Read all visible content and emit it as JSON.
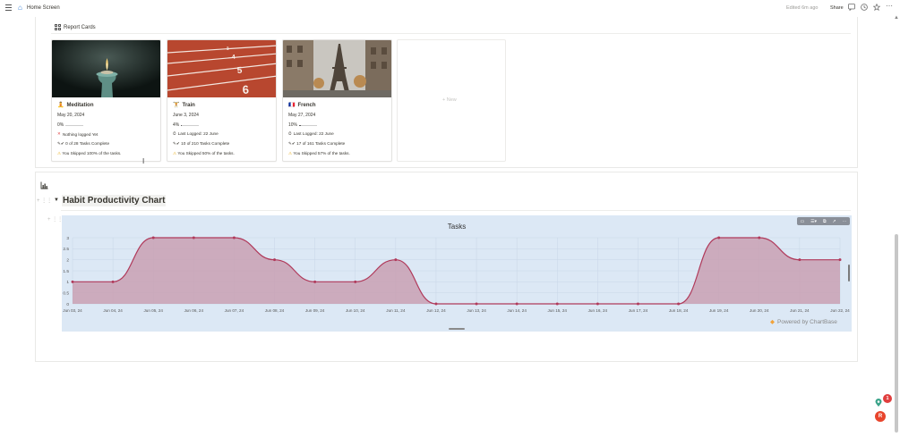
{
  "topbar": {
    "title": "Home Screen",
    "edited": "Edited 6m ago",
    "share_label": "Share"
  },
  "report_cards": {
    "header": "Report Cards",
    "new_label": "+ New",
    "cards": [
      {
        "title": "Meditation",
        "icon": "🧘",
        "date": "May 20, 2024",
        "progress": "0%",
        "progress_value": 0,
        "status_icon": "✕",
        "status_color": "#e03e3e",
        "status": "Nothing logged Yet",
        "tasks": "0 of 28 Tasks Complete",
        "skipped": "You Skipped 100% of the tasks."
      },
      {
        "title": "Train",
        "icon": "🏋",
        "date": "June 3, 2024",
        "progress": "4%",
        "progress_value": 4,
        "status_icon": "⏱",
        "status_color": "#37352f",
        "status": "Last Logged: 22 June",
        "tasks": "10 of 210 Tasks Complete",
        "skipped": "You Skipped 50% of the tasks."
      },
      {
        "title": "French",
        "icon": "🇫🇷",
        "date": "May 27, 2024",
        "progress": "10%",
        "progress_value": 10,
        "status_icon": "⏱",
        "status_color": "#37352f",
        "status": "Last Logged: 22 June",
        "tasks": "17 of 161 Tasks Complete",
        "skipped": "You Skipped 57% of the tasks."
      }
    ]
  },
  "habit_section": {
    "title": "Habit Productivity Chart",
    "powered_by": "Powered by ChartBase"
  },
  "chart_data": {
    "type": "area",
    "title": "Tasks",
    "x": [
      "Jun 03, 24",
      "Jun 04, 24",
      "Jun 05, 24",
      "Jun 06, 24",
      "Jun 07, 24",
      "Jun 08, 24",
      "Jun 09, 24",
      "Jun 10, 24",
      "Jun 11, 24",
      "Jun 12, 24",
      "Jun 13, 24",
      "Jun 14, 24",
      "Jun 15, 24",
      "Jun 16, 24",
      "Jun 17, 24",
      "Jun 18, 24",
      "Jun 19, 24",
      "Jun 20, 24",
      "Jun 21, 24",
      "Jun 22, 24"
    ],
    "values": [
      1,
      1,
      3,
      3,
      3,
      2,
      1,
      1,
      2,
      0,
      0,
      0,
      0,
      0,
      0,
      0,
      3,
      3,
      2,
      2
    ],
    "yticks": [
      "0",
      "0.5",
      "1",
      "1.5",
      "2",
      "2.5",
      "3"
    ],
    "ylim": [
      0,
      3
    ],
    "grid": true,
    "line_color": "#b03a5b",
    "fill_color": "#c9a0b3"
  },
  "colors": {
    "chart_background": "#dce8f5",
    "badge": "#e03e3e",
    "avatar": "#e8452c"
  },
  "floating": {
    "notification_count": "1",
    "avatar_letter": "R"
  }
}
